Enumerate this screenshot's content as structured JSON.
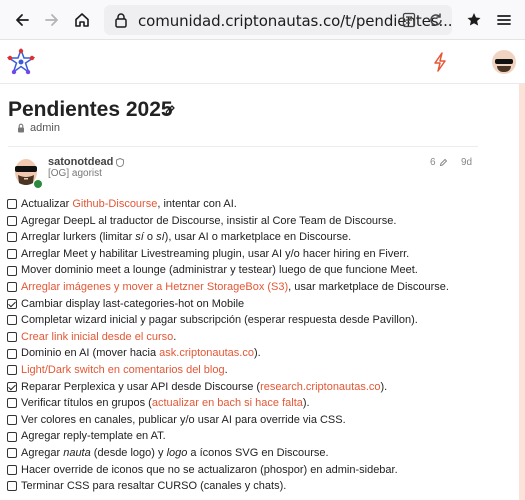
{
  "browser": {
    "url": "comunidad.criptonautas.co/t/pendientes..."
  },
  "topic": {
    "title": "Pendientes 2025",
    "category": "admin"
  },
  "post": {
    "username": "satonotdead",
    "user_title": "[OG] agorist",
    "edit_count": "6",
    "date": "9d"
  },
  "tasks": [
    {
      "checked": false,
      "parts": [
        {
          "t": "Actualizar "
        },
        {
          "t": "Github-Discourse",
          "link": true
        },
        {
          "t": ", intentar con AI."
        }
      ]
    },
    {
      "checked": false,
      "parts": [
        {
          "t": "Agregar DeepL al traductor de Discourse, insistir al Core Team de Discourse."
        }
      ]
    },
    {
      "checked": false,
      "parts": [
        {
          "t": "Arreglar lurkers (limitar "
        },
        {
          "t": "sí",
          "em": true
        },
        {
          "t": " o "
        },
        {
          "t": "sí",
          "em": true
        },
        {
          "t": "), usar AI o marketplace en Discourse."
        }
      ]
    },
    {
      "checked": false,
      "parts": [
        {
          "t": "Arreglar Meet y habilitar Livestreaming plugin, usar AI y/o hacer hiring en Fiverr."
        }
      ]
    },
    {
      "checked": false,
      "parts": [
        {
          "t": "Mover dominio meet a lounge (administrar y testear) luego de que funcione Meet."
        }
      ]
    },
    {
      "checked": false,
      "parts": [
        {
          "t": "Arreglar imágenes y mover a Hetzner StorageBox (S3)",
          "link": true
        },
        {
          "t": ", usar marketplace de Discourse."
        }
      ]
    },
    {
      "checked": true,
      "parts": [
        {
          "t": "Cambiar display last-categories-hot on Mobile"
        }
      ]
    },
    {
      "checked": false,
      "parts": [
        {
          "t": "Completar wizard inicial y pagar subscripción (esperar respuesta desde Pavillon)."
        }
      ]
    },
    {
      "checked": false,
      "parts": [
        {
          "t": "Crear link inicial desde el curso",
          "link": true
        },
        {
          "t": "."
        }
      ]
    },
    {
      "checked": false,
      "parts": [
        {
          "t": "Dominio en AI (mover hacia "
        },
        {
          "t": "ask.criptonautas.co",
          "link": true
        },
        {
          "t": ")."
        }
      ]
    },
    {
      "checked": false,
      "parts": [
        {
          "t": "Light/Dark switch en comentarios del blog",
          "link": true
        },
        {
          "t": "."
        }
      ]
    },
    {
      "checked": true,
      "parts": [
        {
          "t": "Reparar Perplexica y usar API desde Discourse ("
        },
        {
          "t": "research.criptonautas.co",
          "link": true
        },
        {
          "t": ")."
        }
      ]
    },
    {
      "checked": false,
      "parts": [
        {
          "t": "Verificar títulos en grupos ("
        },
        {
          "t": "actualizar en bach si hace falta",
          "link": true
        },
        {
          "t": ")."
        }
      ]
    },
    {
      "checked": false,
      "parts": [
        {
          "t": "Ver colores en canales, publicar y/o usar AI para override via CSS."
        }
      ]
    },
    {
      "checked": false,
      "parts": [
        {
          "t": "Agregar reply-template en AT."
        }
      ]
    },
    {
      "checked": false,
      "parts": [
        {
          "t": "Agregar "
        },
        {
          "t": "nauta",
          "em": true
        },
        {
          "t": " (desde logo) y "
        },
        {
          "t": "logo",
          "em": true
        },
        {
          "t": " a íconos SVG en Discourse."
        }
      ]
    },
    {
      "checked": false,
      "parts": [
        {
          "t": "Hacer override de iconos que no se actualizaron (phospor) en admin-sidebar."
        }
      ]
    },
    {
      "checked": false,
      "parts": [
        {
          "t": "Terminar CSS para resaltar CURSO (canales y chats)."
        }
      ]
    }
  ],
  "colors": {
    "accent": "#e45735",
    "accent_bg": "#fbe3d9",
    "text": "#222222"
  },
  "icons": {
    "back": "arrow-left-icon",
    "forward": "arrow-right-icon",
    "home": "home-icon",
    "lock": "lock-icon",
    "reader": "reader-view-icon",
    "reload": "reload-icon",
    "extensions": "extensions-icon",
    "menu": "hamburger-menu-icon",
    "logo": "site-logo-icon",
    "activity": "lightning-icon",
    "edit": "pencil-icon",
    "category": "lock-icon",
    "shield": "shield-icon"
  }
}
